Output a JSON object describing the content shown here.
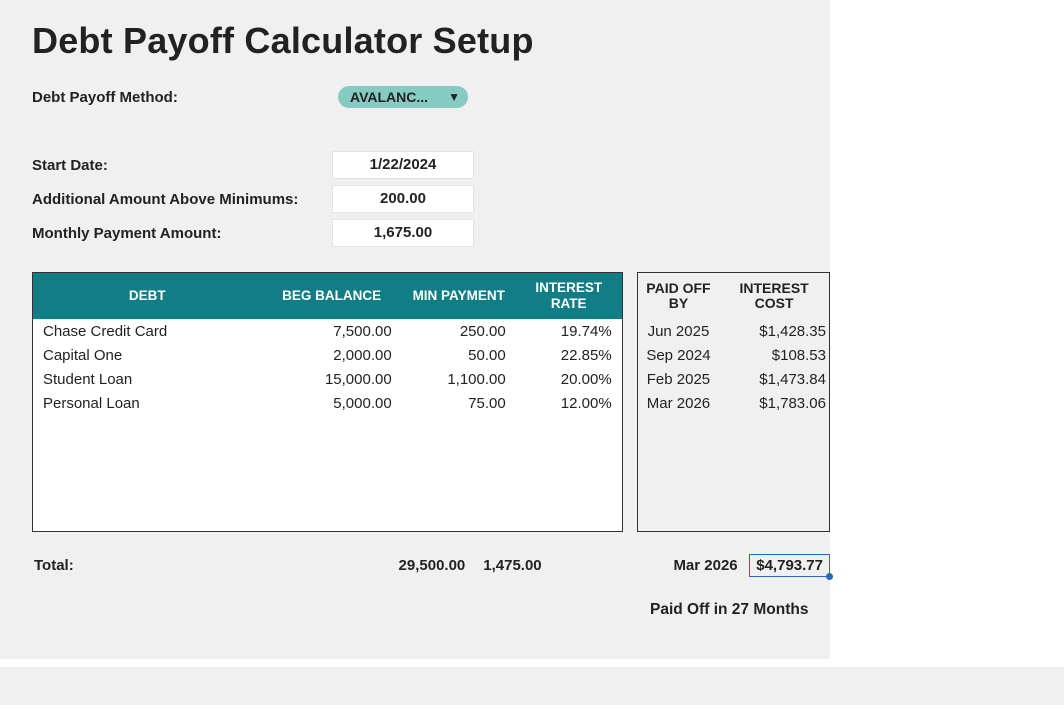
{
  "title": "Debt Payoff Calculator Setup",
  "config": {
    "method_label": "Debt Payoff Method:",
    "method_value": "AVALANC...",
    "start_label": "Start Date:",
    "start_value": "1/22/2024",
    "additional_label": "Additional Amount Above Minimums:",
    "additional_value": "200.00",
    "monthly_label": "Monthly Payment Amount:",
    "monthly_value": "1,675.00"
  },
  "table": {
    "headers": {
      "debt": "DEBT",
      "balance": "BEG BALANCE",
      "min": "MIN PAYMENT",
      "rate": "INTEREST RATE",
      "paidoff": "PAID OFF BY",
      "cost": "INTEREST COST"
    },
    "rows": [
      {
        "debt": "Chase Credit Card",
        "balance": "7,500.00",
        "min": "250.00",
        "rate": "19.74%",
        "paidoff": "Jun 2025",
        "cost": "$1,428.35"
      },
      {
        "debt": "Capital One",
        "balance": "2,000.00",
        "min": "50.00",
        "rate": "22.85%",
        "paidoff": "Sep 2024",
        "cost": "$108.53"
      },
      {
        "debt": "Student Loan",
        "balance": "15,000.00",
        "min": "1,100.00",
        "rate": "20.00%",
        "paidoff": "Feb 2025",
        "cost": "$1,473.84"
      },
      {
        "debt": "Personal Loan",
        "balance": "5,000.00",
        "min": "75.00",
        "rate": "12.00%",
        "paidoff": "Mar 2026",
        "cost": "$1,783.06"
      }
    ]
  },
  "totals": {
    "label": "Total:",
    "balance": "29,500.00",
    "min": "1,475.00",
    "paidoff": "Mar 2026",
    "cost": "$4,793.77"
  },
  "note": "Paid Off in 27 Months"
}
